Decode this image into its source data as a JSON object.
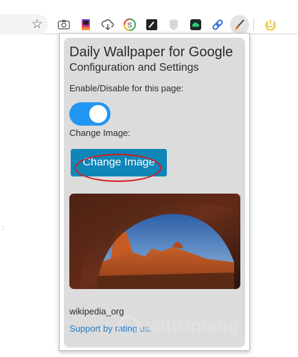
{
  "popup": {
    "title": "Daily Wallpaper for Google",
    "subtitle": "Configuration and Settings",
    "enable_label": "Enable/Disable for this page:",
    "toggle_state": "on",
    "change_image_label": "Change Image:",
    "change_image_button": "Change Image",
    "image_source": "wikipedia_org",
    "support_link": "Support by rating us."
  },
  "colors": {
    "toggle_on": "#2196f3",
    "button_bg": "#0f86b8",
    "highlight_ring": "#d8181c",
    "link": "#1f7ac8"
  },
  "toolbar": {
    "icons": [
      "star-icon",
      "camera-icon",
      "gradient-extension-icon",
      "cloud-download-icon",
      "circle-s-icon",
      "pen-square-icon",
      "shield-icon",
      "green-cloud-icon",
      "link-icon",
      "brush-icon",
      "bunny-icon"
    ]
  },
  "watermark": {
    "text": "uantrimang"
  }
}
